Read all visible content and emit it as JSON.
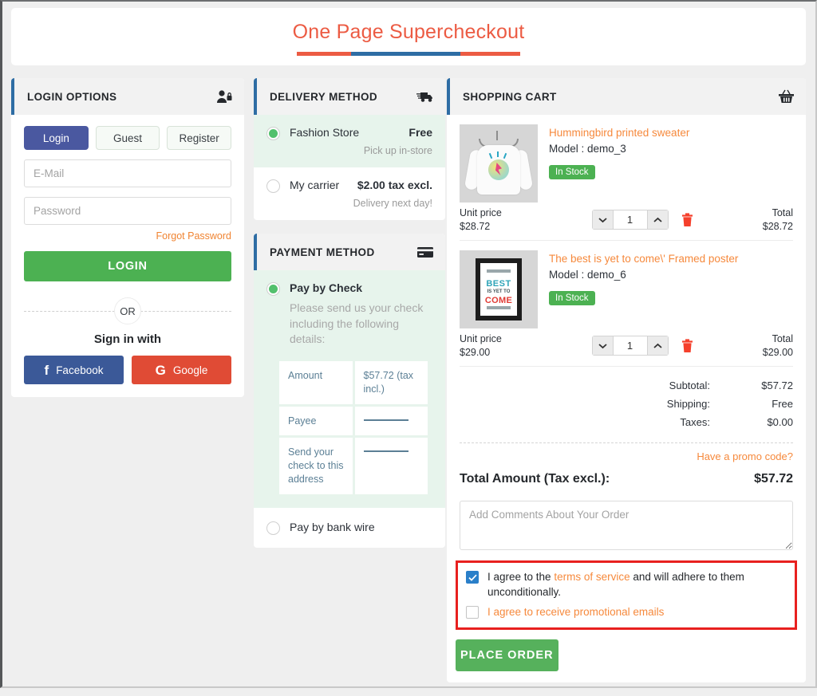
{
  "page": {
    "title": "One Page Supercheckout",
    "accent_title": "#ec5b43",
    "accent_blue": "#2e6da4",
    "accent_orange": "#f6893c",
    "accent_green": "#4cb152",
    "highlight_border": "#e8201f"
  },
  "login": {
    "header": "LOGIN OPTIONS",
    "header_icon": "user-lock-icon",
    "tabs": [
      {
        "label": "Login",
        "active": true
      },
      {
        "label": "Guest",
        "active": false
      },
      {
        "label": "Register",
        "active": false
      }
    ],
    "email_placeholder": "E-Mail",
    "email_value": "",
    "password_placeholder": "Password",
    "password_value": "",
    "forgot_label": "Forgot Password",
    "login_button": "LOGIN",
    "or_label": "OR",
    "sign_in_with": "Sign in with",
    "social": [
      {
        "label": "Facebook",
        "glyph": "f",
        "color": "#3b5998",
        "icon": "facebook-icon"
      },
      {
        "label": "Google",
        "glyph": "G",
        "color": "#e04b35",
        "icon": "google-icon"
      }
    ]
  },
  "delivery": {
    "header": "DELIVERY METHOD",
    "header_icon": "shipping-truck-icon",
    "options": [
      {
        "name": "Fashion Store",
        "price": "Free",
        "note": "Pick up in-store",
        "selected": true
      },
      {
        "name": "My carrier",
        "price": "$2.00 tax excl.",
        "note": "Delivery next day!",
        "selected": false
      }
    ]
  },
  "payment": {
    "header": "PAYMENT METHOD",
    "header_icon": "credit-card-icon",
    "check_option": {
      "name": "Pay by Check",
      "selected": true,
      "description": "Please send us your check including the following details:",
      "rows": [
        {
          "label": "Amount",
          "value": "$57.72 (tax incl.)",
          "is_blank": false
        },
        {
          "label": "Payee",
          "value": "",
          "is_blank": true
        },
        {
          "label": "Send your check to this address",
          "value": "",
          "is_blank": true
        }
      ]
    },
    "wire_option": {
      "name": "Pay by bank wire",
      "selected": false
    }
  },
  "cart": {
    "header": "SHOPPING CART",
    "header_icon": "basket-icon",
    "items": [
      {
        "name": "Hummingbird printed sweater",
        "model": "Model : demo_3",
        "stock": "In Stock",
        "unit_label": "Unit price",
        "unit_price": "$28.72",
        "quantity": "1",
        "total_label": "Total",
        "total_price": "$28.72",
        "thumb": "sweater"
      },
      {
        "name": "The best is yet to come\\' Framed poster",
        "model": "Model : demo_6",
        "stock": "In Stock",
        "unit_label": "Unit price",
        "unit_price": "$29.00",
        "quantity": "1",
        "total_label": "Total",
        "total_price": "$29.00",
        "thumb": "poster"
      }
    ],
    "totals": [
      {
        "label": "Subtotal:",
        "value": "$57.72"
      },
      {
        "label": "Shipping:",
        "value": "Free"
      },
      {
        "label": "Taxes:",
        "value": "$0.00"
      }
    ],
    "promo_label": "Have a promo code?",
    "grand_label": "Total Amount (Tax excl.):",
    "grand_value": "$57.72",
    "comments_placeholder": "Add Comments About Your Order",
    "comments_value": "",
    "agree_terms": {
      "checked": true,
      "prefix": "I agree to the ",
      "link": "terms of service",
      "suffix": " and will adhere to them unconditionally."
    },
    "agree_promo": {
      "checked": false,
      "label": "I agree to receive promotional emails"
    },
    "place_order": "PLACE ORDER"
  }
}
